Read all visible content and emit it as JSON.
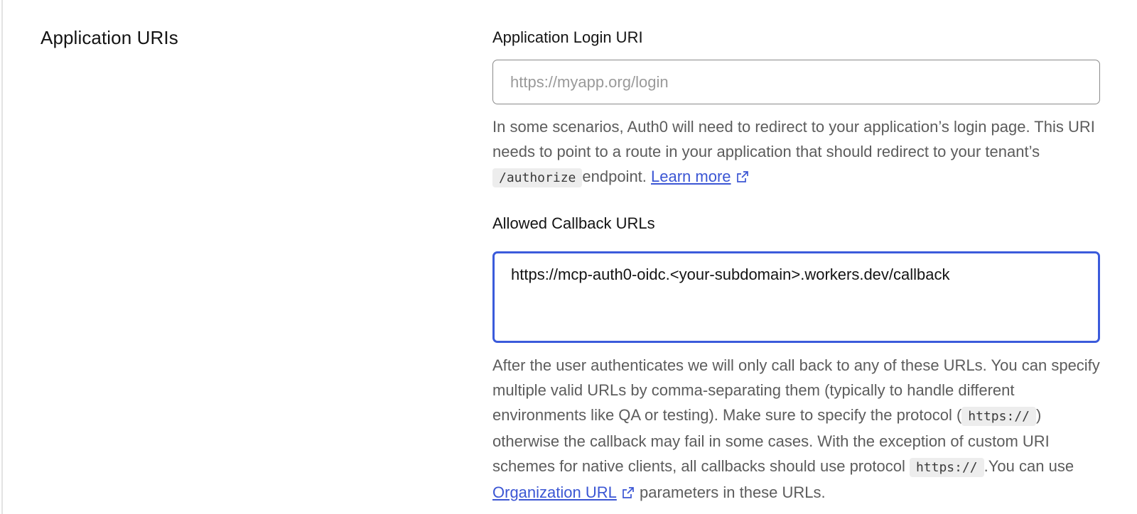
{
  "section": {
    "title": "Application URIs"
  },
  "login_uri": {
    "label": "Application Login URI",
    "placeholder": "https://myapp.org/login",
    "value": "",
    "help_part1": "In some scenarios, Auth0 will need to redirect to your application’s login page. This URI needs to point to a route in your application that should redirect to your tenant’s ",
    "help_code": "/authorize",
    "help_part2": "endpoint. ",
    "help_link": "Learn more"
  },
  "callback_urls": {
    "label": "Allowed Callback URLs",
    "value": "https://mcp-auth0-oidc.<your-subdomain>.workers.dev/callback",
    "help_part1": "After the user authenticates we will only call back to any of these URLs. You can specify multiple valid URLs by comma-separating them (typically to handle different environments like QA or testing). Make sure to specify the protocol (",
    "help_code1": "https://",
    "help_part2": ") otherwise the callback may fail in some cases. With the exception of custom URI schemes for native clients, all callbacks should use protocol ",
    "help_code2": "https://",
    "help_part3": ".You can use ",
    "help_link": "Organization URL",
    "help_part4": " parameters in these URLs."
  },
  "icons": {
    "external_link": "external-link-icon"
  },
  "colors": {
    "link": "#3b56d4",
    "focus_border": "#3b5bdb",
    "help_text": "#5c5c5c"
  }
}
